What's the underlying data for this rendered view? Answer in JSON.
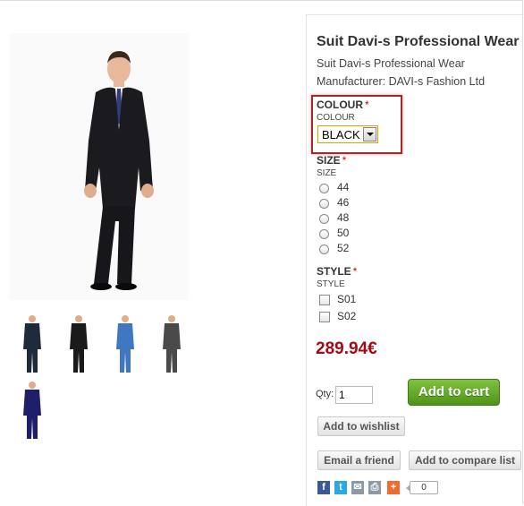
{
  "product": {
    "title": "Suit Davi-s Professional Wear",
    "subtitle": "Suit Davi-s Professional Wear",
    "manufacturer": "Manufacturer: DAVI-s Fashion Ltd",
    "price": "289.94€"
  },
  "colour": {
    "label": "COLOUR",
    "required_mark": "*",
    "sublabel": "COLOUR",
    "selected": "BLACK"
  },
  "size": {
    "label": "SIZE",
    "required_mark": "*",
    "sublabel": "SIZE",
    "options": [
      "44",
      "46",
      "48",
      "50",
      "52"
    ]
  },
  "style": {
    "label": "STYLE",
    "required_mark": "*",
    "sublabel": "STYLE",
    "options": [
      "S01",
      "S02"
    ]
  },
  "cart": {
    "qty_label": "Qty:",
    "qty_value": "1",
    "add_to_cart": "Add to cart",
    "add_to_wishlist": "Add to wishlist",
    "email_friend": "Email a friend",
    "add_to_compare": "Add to compare list"
  },
  "share": {
    "facebook_icon": "facebook-icon",
    "twitter_icon": "twitter-icon",
    "email_icon": "email-icon",
    "print_icon": "print-icon",
    "plus_icon": "plus-icon",
    "count": "0"
  },
  "colors": {
    "price": "#a50a14",
    "cart_button": "#5ea324",
    "highlight_border": "#a52a2a",
    "thumb_suits": [
      "#1f2a3a",
      "#1a1a1a",
      "#3f78c0",
      "#4a4a4a",
      "#1e1e6a"
    ]
  }
}
